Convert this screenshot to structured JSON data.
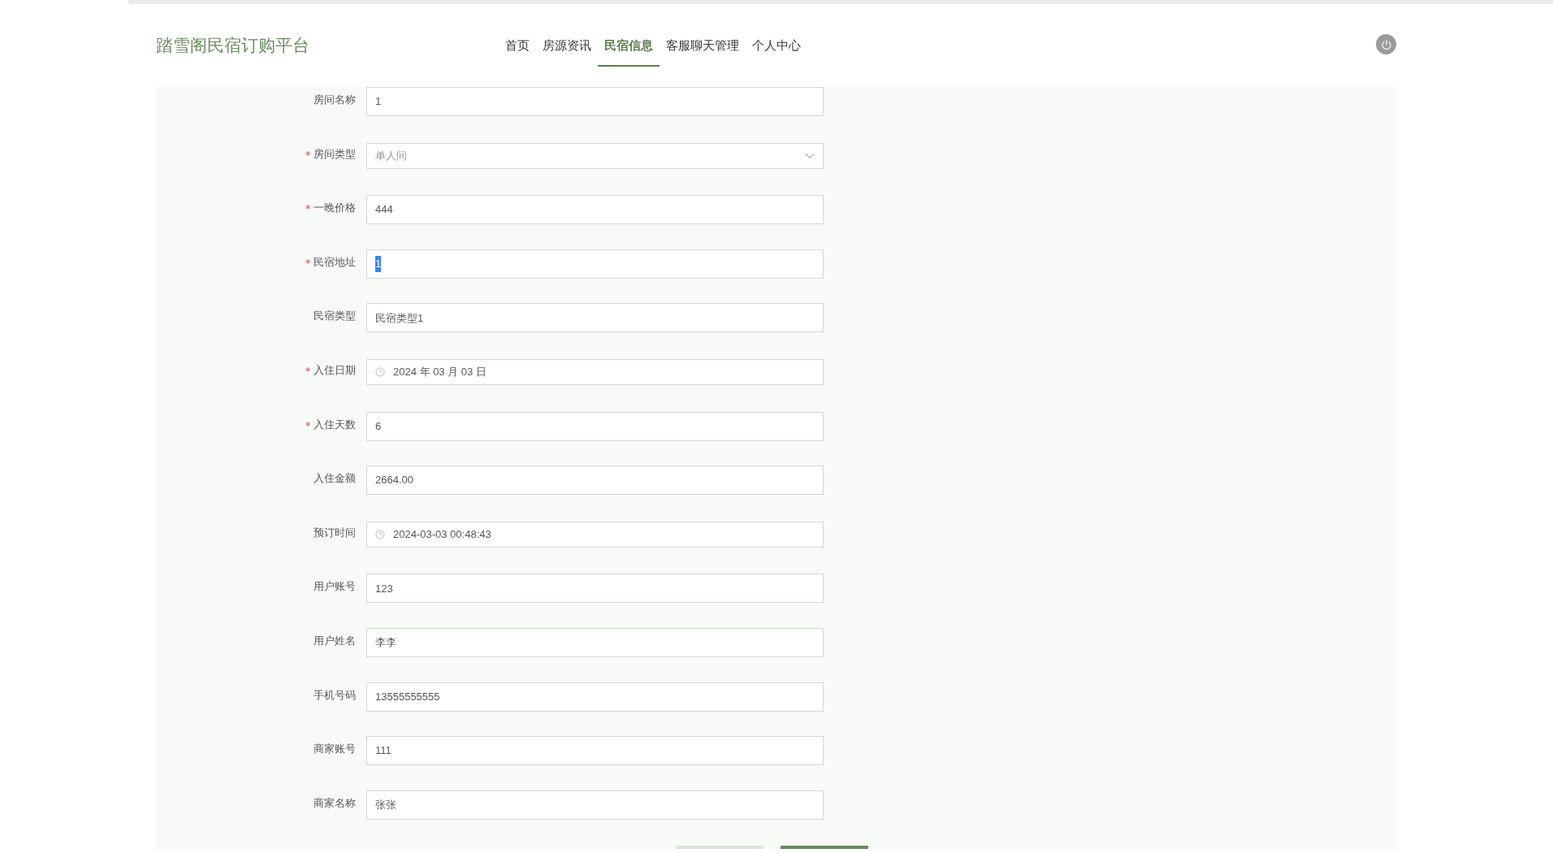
{
  "header": {
    "title": "踏雪阁民宿订购平台",
    "nav": [
      {
        "label": "首页",
        "selected": false
      },
      {
        "label": "房源资讯",
        "selected": false
      },
      {
        "label": "民宿信息",
        "selected": true
      },
      {
        "label": "客服聊天管理",
        "selected": false
      },
      {
        "label": "个人中心",
        "selected": false
      }
    ]
  },
  "form": {
    "fields": [
      {
        "label": "房间名称",
        "required": false,
        "kind": "text",
        "value": "1"
      },
      {
        "label": "房间类型",
        "required": true,
        "kind": "select",
        "value": "单人间"
      },
      {
        "label": "一晚价格",
        "required": true,
        "kind": "text",
        "value": "444"
      },
      {
        "label": "民宿地址",
        "required": true,
        "kind": "text",
        "value": "1",
        "highlighted": true
      },
      {
        "label": "民宿类型",
        "required": false,
        "kind": "text",
        "value": "民宿类型1"
      },
      {
        "label": "入住日期",
        "required": true,
        "kind": "date",
        "value": "2024 年 03 月 03 日"
      },
      {
        "label": "入住天数",
        "required": true,
        "kind": "text",
        "value": "6"
      },
      {
        "label": "入住金额",
        "required": false,
        "kind": "text",
        "value": "2664.00"
      },
      {
        "label": "预订时间",
        "required": false,
        "kind": "date",
        "value": "2024-03-03 00:48:43"
      },
      {
        "label": "用户账号",
        "required": false,
        "kind": "text",
        "value": "123"
      },
      {
        "label": "用户姓名",
        "required": false,
        "kind": "text",
        "value": "李李"
      },
      {
        "label": "手机号码",
        "required": false,
        "kind": "text",
        "value": "13555555555"
      },
      {
        "label": "商家账号",
        "required": false,
        "kind": "text",
        "value": "111"
      },
      {
        "label": "商家名称",
        "required": false,
        "kind": "text",
        "value": "张张"
      }
    ],
    "buttons": [
      {
        "kind": "secondary"
      },
      {
        "kind": "primary"
      }
    ]
  }
}
